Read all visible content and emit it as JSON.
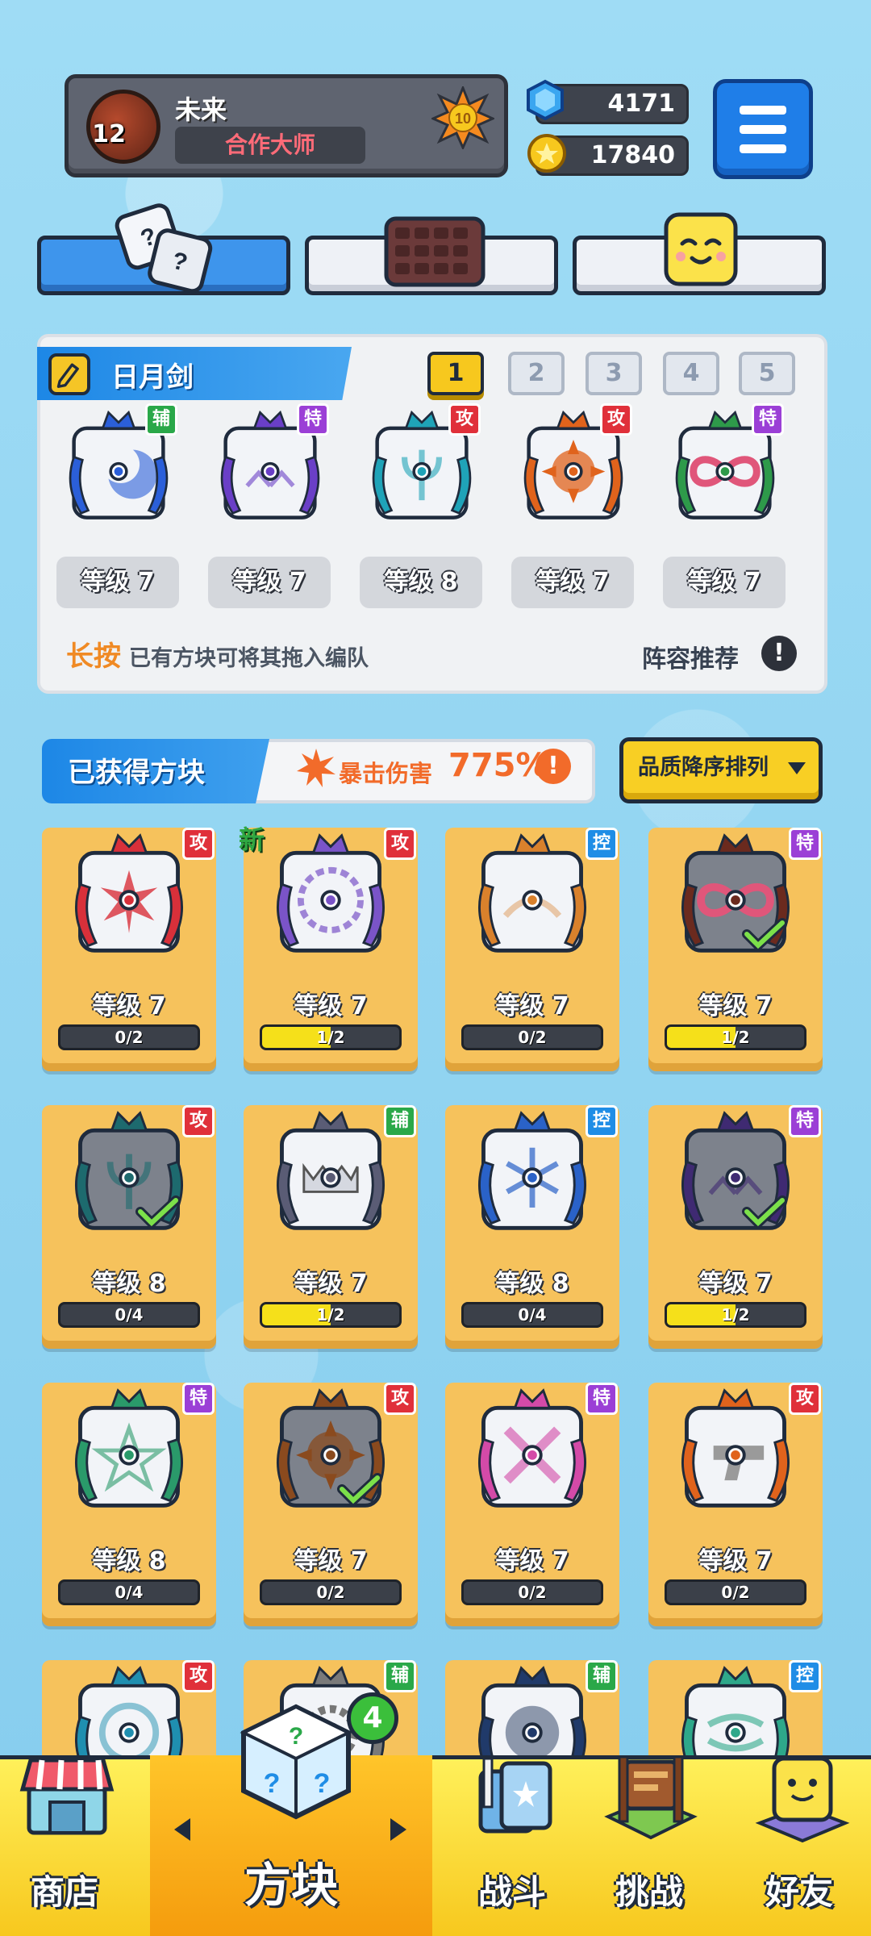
{
  "player": {
    "level": "12",
    "name": "未来",
    "title": "合作大师",
    "rank_badge": "10"
  },
  "currency": {
    "gems": "4171",
    "coins": "17840"
  },
  "deck": {
    "name": "日月剑",
    "tabs": [
      "1",
      "2",
      "3",
      "4",
      "5"
    ],
    "active_tab": 0,
    "slots": [
      {
        "type": "辅",
        "level": "等级 7",
        "color": "#2b5fd9",
        "icon": "moon-icon"
      },
      {
        "type": "特",
        "level": "等级 7",
        "color": "#6a3fc7",
        "icon": "arrows-up-icon"
      },
      {
        "type": "攻",
        "level": "等级 8",
        "color": "#1fa3b8",
        "icon": "trident-icon"
      },
      {
        "type": "攻",
        "level": "等级 7",
        "color": "#e0631c",
        "icon": "sun-icon"
      },
      {
        "type": "特",
        "level": "等级 7",
        "color": "#2e9a4a",
        "icon": "infinity-icon"
      }
    ],
    "hint_key": "长按",
    "hint_text": "已有方块可将其拖入编队",
    "recommend": "阵容推荐",
    "recommend_icon": "!"
  },
  "owned": {
    "title": "已获得方块",
    "crit_label": "暴击伤害",
    "crit_value": "775%",
    "crit_icon": "!",
    "sort_label": "品质降序排列",
    "new_label": "新",
    "blocks": [
      {
        "type": "攻",
        "tag": "atk",
        "level": "等级 7",
        "progress": "0/2",
        "fill": 0,
        "color": "#d8303a",
        "icon": "star-burst-icon"
      },
      {
        "type": "攻",
        "tag": "atk",
        "level": "等级 7",
        "progress": "1/2",
        "fill": 0.5,
        "color": "#7a54c8",
        "icon": "saw-icon"
      },
      {
        "type": "控",
        "tag": "ctl",
        "level": "等级 7",
        "progress": "0/2",
        "fill": 0,
        "color": "#d9812c",
        "icon": "sand-icon"
      },
      {
        "type": "特",
        "tag": "spe",
        "level": "等级 7",
        "progress": "1/2",
        "fill": 0.5,
        "color": "#6b2a1e",
        "icon": "infinity-icon",
        "equipped": true
      },
      {
        "type": "攻",
        "tag": "atk",
        "level": "等级 8",
        "progress": "0/4",
        "fill": 0,
        "color": "#1d6a6e",
        "icon": "trident-icon",
        "equipped": true
      },
      {
        "type": "辅",
        "tag": "sup",
        "level": "等级 7",
        "progress": "1/2",
        "fill": 0.5,
        "color": "#5a5c75",
        "icon": "jaw-icon"
      },
      {
        "type": "控",
        "tag": "ctl",
        "level": "等级 8",
        "progress": "0/4",
        "fill": 0,
        "color": "#2a62c8",
        "icon": "snowflake-icon"
      },
      {
        "type": "特",
        "tag": "spe",
        "level": "等级 7",
        "progress": "1/2",
        "fill": 0.5,
        "color": "#3f2a72",
        "icon": "arrows-up-icon",
        "equipped": true
      },
      {
        "type": "特",
        "tag": "spe",
        "level": "等级 8",
        "progress": "0/4",
        "fill": 0,
        "color": "#2a9a6a",
        "icon": "pentagram-icon"
      },
      {
        "type": "攻",
        "tag": "atk",
        "level": "等级 7",
        "progress": "0/2",
        "fill": 0,
        "color": "#8a4a1e",
        "icon": "sun-icon",
        "equipped": true
      },
      {
        "type": "特",
        "tag": "spe",
        "level": "等级 7",
        "progress": "0/2",
        "fill": 0,
        "color": "#d44aa8",
        "icon": "cross-syringe-icon"
      },
      {
        "type": "攻",
        "tag": "atk",
        "level": "等级 7",
        "progress": "0/2",
        "fill": 0,
        "color": "#e0631c",
        "icon": "pistol-icon"
      },
      {
        "type": "攻",
        "tag": "atk",
        "level": "",
        "progress": "",
        "fill": 0,
        "color": "#1f8fb0",
        "icon": "vortex-icon"
      },
      {
        "type": "辅",
        "tag": "sup",
        "level": "",
        "progress": "",
        "fill": 0,
        "color": "#7a7a7a",
        "icon": "gear-icon"
      },
      {
        "type": "辅",
        "tag": "sup",
        "level": "",
        "progress": "",
        "fill": 0,
        "color": "#203a6a",
        "icon": "orb-icon"
      },
      {
        "type": "控",
        "tag": "ctl",
        "level": "",
        "progress": "",
        "fill": 0,
        "color": "#2ea88a",
        "icon": "wind-icon"
      }
    ]
  },
  "nav": {
    "shop": "商店",
    "blocks": "方块",
    "battle": "战斗",
    "challenge": "挑战",
    "friends": "好友",
    "blocks_badge": "4"
  },
  "colors": {
    "accent_blue": "#1d87e6",
    "gold": "#f7c81e",
    "panel_dark": "#5f6470"
  }
}
